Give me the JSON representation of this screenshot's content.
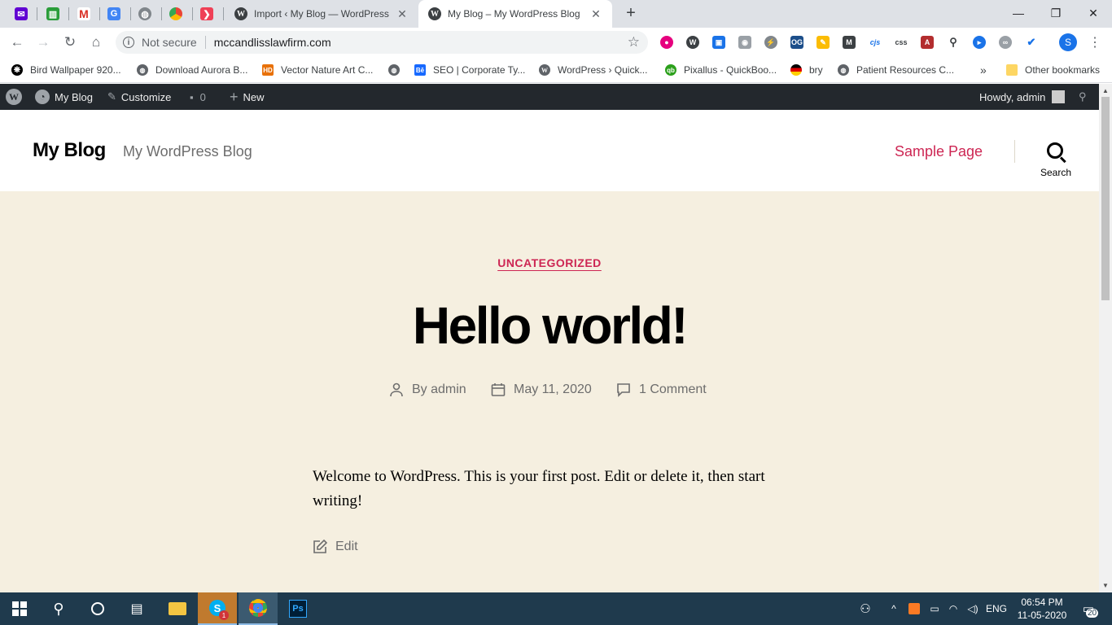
{
  "browser": {
    "tabs": [
      {
        "title": "Import ‹ My Blog — WordPress",
        "active": false
      },
      {
        "title": "My Blog – My WordPress Blog",
        "active": true
      }
    ],
    "pinned_icons": [
      "gmail-like-mail-icon",
      "trello-icon",
      "gmail-icon",
      "google-translate-icon",
      "globe-icon",
      "chrome-icon",
      "pocket-icon"
    ],
    "address": {
      "security": "Not secure",
      "url": "mccandlisslawfirm.com"
    },
    "profile_initial": "S",
    "bookmarks": [
      {
        "label": "Bird Wallpaper 920...",
        "icon": "paw-icon"
      },
      {
        "label": "Download Aurora B...",
        "icon": "globe-icon"
      },
      {
        "label": "Vector Nature Art C...",
        "icon": "hd-icon"
      },
      {
        "label": "",
        "icon": "globe-icon"
      },
      {
        "label": "SEO | Corporate Ty...",
        "icon": "behance-icon"
      },
      {
        "label": "WordPress › Quick...",
        "icon": "wordpress-icon"
      },
      {
        "label": "Pixallus - QuickBoo...",
        "icon": "quickbooks-icon"
      },
      {
        "label": "bry",
        "icon": "flag-icon"
      },
      {
        "label": "Patient Resources C...",
        "icon": "globe-icon"
      }
    ],
    "bookmarks_overflow": "»",
    "other_bookmarks": "Other bookmarks"
  },
  "adminbar": {
    "site_name": "My Blog",
    "customize": "Customize",
    "comments_count": "0",
    "new_label": "New",
    "howdy": "Howdy, admin"
  },
  "header": {
    "site_title": "My Blog",
    "site_description": "My WordPress Blog",
    "nav_link": "Sample Page",
    "search_label": "Search"
  },
  "post": {
    "category": "UNCATEGORIZED",
    "title": "Hello world!",
    "author": "By admin",
    "date": "May 11, 2020",
    "comments": "1 Comment",
    "body": "Welcome to WordPress. This is your first post. Edit or delete it, then start writing!",
    "edit_label": "Edit"
  },
  "taskbar": {
    "language": "ENG",
    "time": "06:54 PM",
    "date": "11-05-2020",
    "notifications": "20",
    "skype_badge": "1"
  },
  "colors": {
    "accent": "#cd2653",
    "content_bg": "#f5efe0",
    "adminbar_bg": "#23282d",
    "taskbar_bg": "#1f3a4d"
  }
}
